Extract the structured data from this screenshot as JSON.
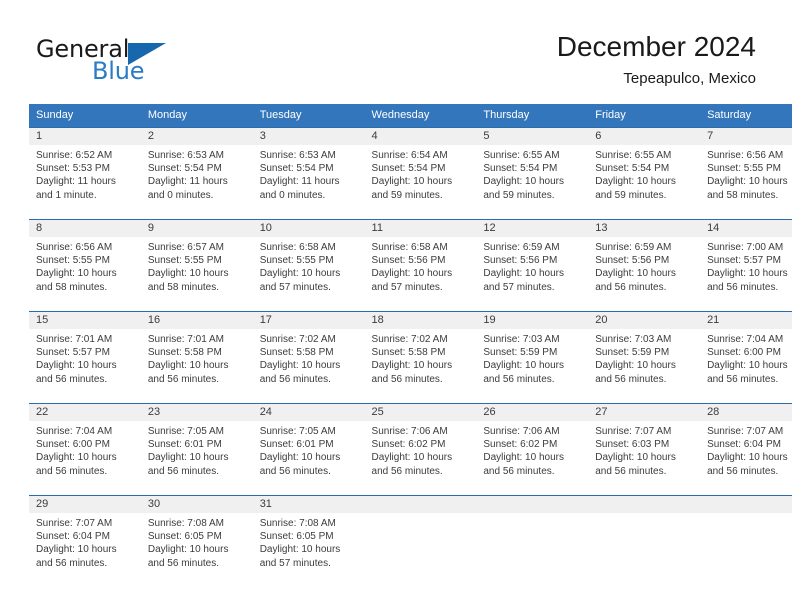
{
  "brand": {
    "word1": "General",
    "word2": "Blue",
    "accent_color": "#1667ae",
    "blue_text_color": "#2b7cc4"
  },
  "header": {
    "title": "December 2024",
    "subtitle": "Tepeapulco, Mexico"
  },
  "theme": {
    "header_bg": "#3476bc",
    "daynum_bg": "#f0f0f0",
    "row_border": "#2b6cab",
    "text": "#3c3c3c"
  },
  "weekday_headers": [
    "Sunday",
    "Monday",
    "Tuesday",
    "Wednesday",
    "Thursday",
    "Friday",
    "Saturday"
  ],
  "weeks": [
    {
      "days": [
        {
          "num": "1",
          "sunrise": "Sunrise: 6:52 AM",
          "sunset": "Sunset: 5:53 PM",
          "daylight1": "Daylight: 11 hours",
          "daylight2": "and 1 minute."
        },
        {
          "num": "2",
          "sunrise": "Sunrise: 6:53 AM",
          "sunset": "Sunset: 5:54 PM",
          "daylight1": "Daylight: 11 hours",
          "daylight2": "and 0 minutes."
        },
        {
          "num": "3",
          "sunrise": "Sunrise: 6:53 AM",
          "sunset": "Sunset: 5:54 PM",
          "daylight1": "Daylight: 11 hours",
          "daylight2": "and 0 minutes."
        },
        {
          "num": "4",
          "sunrise": "Sunrise: 6:54 AM",
          "sunset": "Sunset: 5:54 PM",
          "daylight1": "Daylight: 10 hours",
          "daylight2": "and 59 minutes."
        },
        {
          "num": "5",
          "sunrise": "Sunrise: 6:55 AM",
          "sunset": "Sunset: 5:54 PM",
          "daylight1": "Daylight: 10 hours",
          "daylight2": "and 59 minutes."
        },
        {
          "num": "6",
          "sunrise": "Sunrise: 6:55 AM",
          "sunset": "Sunset: 5:54 PM",
          "daylight1": "Daylight: 10 hours",
          "daylight2": "and 59 minutes."
        },
        {
          "num": "7",
          "sunrise": "Sunrise: 6:56 AM",
          "sunset": "Sunset: 5:55 PM",
          "daylight1": "Daylight: 10 hours",
          "daylight2": "and 58 minutes."
        }
      ]
    },
    {
      "days": [
        {
          "num": "8",
          "sunrise": "Sunrise: 6:56 AM",
          "sunset": "Sunset: 5:55 PM",
          "daylight1": "Daylight: 10 hours",
          "daylight2": "and 58 minutes."
        },
        {
          "num": "9",
          "sunrise": "Sunrise: 6:57 AM",
          "sunset": "Sunset: 5:55 PM",
          "daylight1": "Daylight: 10 hours",
          "daylight2": "and 58 minutes."
        },
        {
          "num": "10",
          "sunrise": "Sunrise: 6:58 AM",
          "sunset": "Sunset: 5:55 PM",
          "daylight1": "Daylight: 10 hours",
          "daylight2": "and 57 minutes."
        },
        {
          "num": "11",
          "sunrise": "Sunrise: 6:58 AM",
          "sunset": "Sunset: 5:56 PM",
          "daylight1": "Daylight: 10 hours",
          "daylight2": "and 57 minutes."
        },
        {
          "num": "12",
          "sunrise": "Sunrise: 6:59 AM",
          "sunset": "Sunset: 5:56 PM",
          "daylight1": "Daylight: 10 hours",
          "daylight2": "and 57 minutes."
        },
        {
          "num": "13",
          "sunrise": "Sunrise: 6:59 AM",
          "sunset": "Sunset: 5:56 PM",
          "daylight1": "Daylight: 10 hours",
          "daylight2": "and 56 minutes."
        },
        {
          "num": "14",
          "sunrise": "Sunrise: 7:00 AM",
          "sunset": "Sunset: 5:57 PM",
          "daylight1": "Daylight: 10 hours",
          "daylight2": "and 56 minutes."
        }
      ]
    },
    {
      "days": [
        {
          "num": "15",
          "sunrise": "Sunrise: 7:01 AM",
          "sunset": "Sunset: 5:57 PM",
          "daylight1": "Daylight: 10 hours",
          "daylight2": "and 56 minutes."
        },
        {
          "num": "16",
          "sunrise": "Sunrise: 7:01 AM",
          "sunset": "Sunset: 5:58 PM",
          "daylight1": "Daylight: 10 hours",
          "daylight2": "and 56 minutes."
        },
        {
          "num": "17",
          "sunrise": "Sunrise: 7:02 AM",
          "sunset": "Sunset: 5:58 PM",
          "daylight1": "Daylight: 10 hours",
          "daylight2": "and 56 minutes."
        },
        {
          "num": "18",
          "sunrise": "Sunrise: 7:02 AM",
          "sunset": "Sunset: 5:58 PM",
          "daylight1": "Daylight: 10 hours",
          "daylight2": "and 56 minutes."
        },
        {
          "num": "19",
          "sunrise": "Sunrise: 7:03 AM",
          "sunset": "Sunset: 5:59 PM",
          "daylight1": "Daylight: 10 hours",
          "daylight2": "and 56 minutes."
        },
        {
          "num": "20",
          "sunrise": "Sunrise: 7:03 AM",
          "sunset": "Sunset: 5:59 PM",
          "daylight1": "Daylight: 10 hours",
          "daylight2": "and 56 minutes."
        },
        {
          "num": "21",
          "sunrise": "Sunrise: 7:04 AM",
          "sunset": "Sunset: 6:00 PM",
          "daylight1": "Daylight: 10 hours",
          "daylight2": "and 56 minutes."
        }
      ]
    },
    {
      "days": [
        {
          "num": "22",
          "sunrise": "Sunrise: 7:04 AM",
          "sunset": "Sunset: 6:00 PM",
          "daylight1": "Daylight: 10 hours",
          "daylight2": "and 56 minutes."
        },
        {
          "num": "23",
          "sunrise": "Sunrise: 7:05 AM",
          "sunset": "Sunset: 6:01 PM",
          "daylight1": "Daylight: 10 hours",
          "daylight2": "and 56 minutes."
        },
        {
          "num": "24",
          "sunrise": "Sunrise: 7:05 AM",
          "sunset": "Sunset: 6:01 PM",
          "daylight1": "Daylight: 10 hours",
          "daylight2": "and 56 minutes."
        },
        {
          "num": "25",
          "sunrise": "Sunrise: 7:06 AM",
          "sunset": "Sunset: 6:02 PM",
          "daylight1": "Daylight: 10 hours",
          "daylight2": "and 56 minutes."
        },
        {
          "num": "26",
          "sunrise": "Sunrise: 7:06 AM",
          "sunset": "Sunset: 6:02 PM",
          "daylight1": "Daylight: 10 hours",
          "daylight2": "and 56 minutes."
        },
        {
          "num": "27",
          "sunrise": "Sunrise: 7:07 AM",
          "sunset": "Sunset: 6:03 PM",
          "daylight1": "Daylight: 10 hours",
          "daylight2": "and 56 minutes."
        },
        {
          "num": "28",
          "sunrise": "Sunrise: 7:07 AM",
          "sunset": "Sunset: 6:04 PM",
          "daylight1": "Daylight: 10 hours",
          "daylight2": "and 56 minutes."
        }
      ]
    },
    {
      "days": [
        {
          "num": "29",
          "sunrise": "Sunrise: 7:07 AM",
          "sunset": "Sunset: 6:04 PM",
          "daylight1": "Daylight: 10 hours",
          "daylight2": "and 56 minutes."
        },
        {
          "num": "30",
          "sunrise": "Sunrise: 7:08 AM",
          "sunset": "Sunset: 6:05 PM",
          "daylight1": "Daylight: 10 hours",
          "daylight2": "and 56 minutes."
        },
        {
          "num": "31",
          "sunrise": "Sunrise: 7:08 AM",
          "sunset": "Sunset: 6:05 PM",
          "daylight1": "Daylight: 10 hours",
          "daylight2": "and 57 minutes."
        },
        {
          "num": "",
          "sunrise": "",
          "sunset": "",
          "daylight1": "",
          "daylight2": ""
        },
        {
          "num": "",
          "sunrise": "",
          "sunset": "",
          "daylight1": "",
          "daylight2": ""
        },
        {
          "num": "",
          "sunrise": "",
          "sunset": "",
          "daylight1": "",
          "daylight2": ""
        },
        {
          "num": "",
          "sunrise": "",
          "sunset": "",
          "daylight1": "",
          "daylight2": ""
        }
      ]
    }
  ]
}
